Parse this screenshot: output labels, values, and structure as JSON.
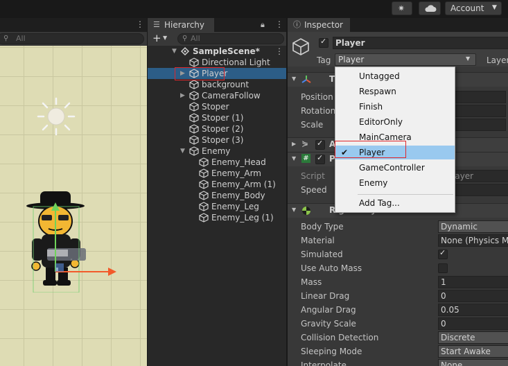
{
  "topbar": {
    "account_label": "Account"
  },
  "scene": {
    "search_placeholder": "All"
  },
  "hierarchy": {
    "tab_label": "Hierarchy",
    "search_placeholder": "All",
    "scene_name": "SampleScene*",
    "items": [
      {
        "label": "Directional Light",
        "indent": 1,
        "arrow": ""
      },
      {
        "label": "Player",
        "indent": 1,
        "arrow": "▶",
        "selected": true
      },
      {
        "label": "backgrount",
        "indent": 1,
        "arrow": ""
      },
      {
        "label": "CameraFollow",
        "indent": 1,
        "arrow": "▶"
      },
      {
        "label": "Stoper",
        "indent": 1,
        "arrow": ""
      },
      {
        "label": "Stoper (1)",
        "indent": 1,
        "arrow": ""
      },
      {
        "label": "Stoper (2)",
        "indent": 1,
        "arrow": ""
      },
      {
        "label": "Stoper (3)",
        "indent": 1,
        "arrow": ""
      },
      {
        "label": "Enemy",
        "indent": 1,
        "arrow": "▼"
      },
      {
        "label": "Enemy_Head",
        "indent": 2,
        "arrow": ""
      },
      {
        "label": "Enemy_Arm",
        "indent": 2,
        "arrow": ""
      },
      {
        "label": "Enemy_Arm (1)",
        "indent": 2,
        "arrow": ""
      },
      {
        "label": "Enemy_Body",
        "indent": 2,
        "arrow": ""
      },
      {
        "label": "Enemy_Leg",
        "indent": 2,
        "arrow": ""
      },
      {
        "label": "Enemy_Leg (1)",
        "indent": 2,
        "arrow": ""
      }
    ]
  },
  "inspector": {
    "tab_label": "Inspector",
    "object_name": "Player",
    "tag_label": "Tag",
    "tag_value": "Player",
    "layer_label": "Layer",
    "transform_rows": [
      {
        "label": "Position"
      },
      {
        "label": "Rotation"
      },
      {
        "label": "Scale"
      }
    ],
    "script_label": "Script",
    "script_value": "layer",
    "speed_label": "Speed",
    "rigidbody_header": "Rigidbody 2D",
    "props": [
      {
        "label": "Body Type",
        "value": "Dynamic",
        "kind": "dropdown"
      },
      {
        "label": "Material",
        "value": "None (Physics Ma",
        "kind": "field"
      },
      {
        "label": "Simulated",
        "value": "✓",
        "kind": "check"
      },
      {
        "label": "Use Auto Mass",
        "value": "",
        "kind": "check"
      },
      {
        "label": "Mass",
        "value": "1",
        "kind": "field"
      },
      {
        "label": "Linear Drag",
        "value": "0",
        "kind": "field"
      },
      {
        "label": "Angular Drag",
        "value": "0.05",
        "kind": "field"
      },
      {
        "label": "Gravity Scale",
        "value": "0",
        "kind": "field"
      },
      {
        "label": "Collision Detection",
        "value": "Discrete",
        "kind": "dropdown"
      },
      {
        "label": "Sleeping Mode",
        "value": "Start Awake",
        "kind": "dropdown"
      },
      {
        "label": "Interpolate",
        "value": "None",
        "kind": "dropdown"
      }
    ]
  },
  "tag_dropdown": {
    "options": [
      {
        "label": "Untagged",
        "checked": false
      },
      {
        "label": "Respawn",
        "checked": false
      },
      {
        "label": "Finish",
        "checked": false
      },
      {
        "label": "EditorOnly",
        "checked": false
      },
      {
        "label": "MainCamera",
        "checked": false
      },
      {
        "label": "Player",
        "checked": true
      },
      {
        "label": "GameController",
        "checked": false
      },
      {
        "label": "Enemy",
        "checked": false
      }
    ],
    "add_tag_label": "Add Tag...",
    "check_mark": "✔"
  },
  "colors": {
    "selection_blue": "#2c5d87",
    "dropdown_highlight": "#99c9ef",
    "highlight_red": "#e0262b"
  }
}
